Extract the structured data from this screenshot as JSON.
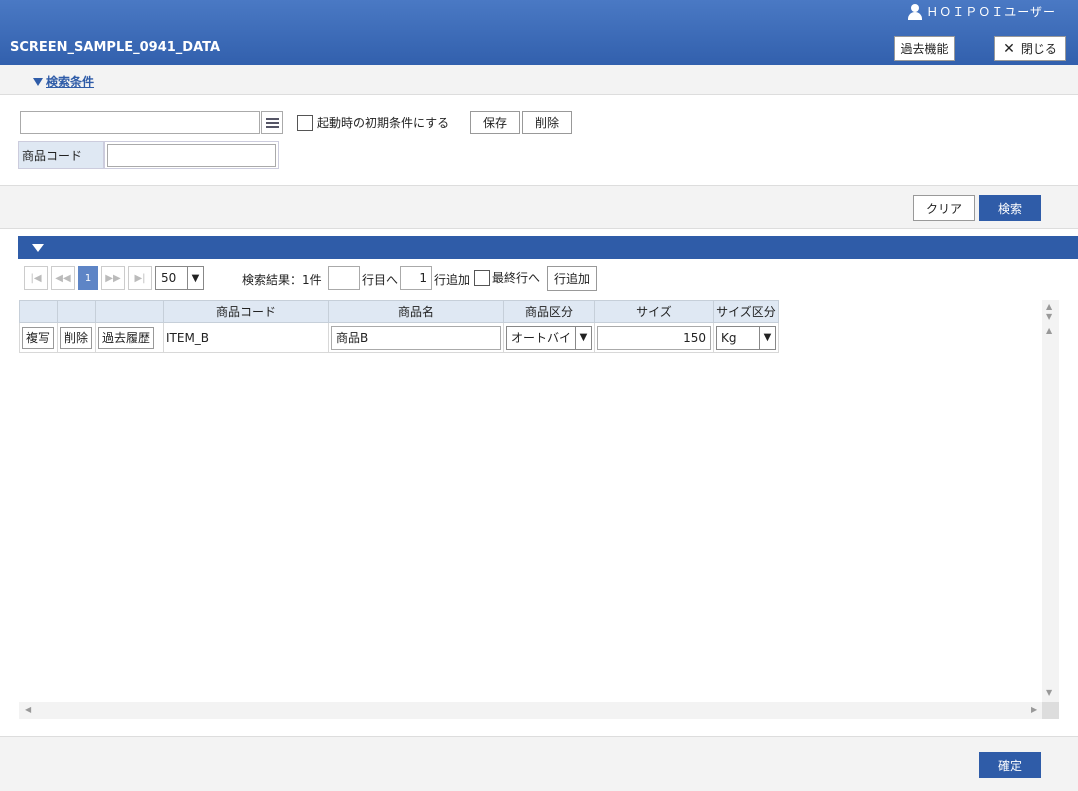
{
  "header": {
    "user": "ＨＯＩＰＯＩユーザー",
    "title": "SCREEN_SAMPLE_0941_DATA",
    "past_button": "過去機能",
    "close_button": "閉じる"
  },
  "search": {
    "toggle_label": "検索条件",
    "initial_condition_label": "起動時の初期条件にする",
    "save_button": "保存",
    "delete_button": "削除",
    "product_code_label": "商品コード",
    "product_code_value": "",
    "clear_button": "クリア",
    "search_button": "検索"
  },
  "pager": {
    "current_page": "1",
    "rows_per_page": "50",
    "result_text": "検索結果：1件",
    "row_to_label": "行目へ",
    "add_count": "1",
    "add_label": "行追加",
    "last_row_label": "最終行へ",
    "add_row_button": "行追加"
  },
  "table": {
    "columns": [
      "",
      "",
      "",
      "商品コード",
      "商品名",
      "商品区分",
      "サイズ",
      "サイズ区分"
    ],
    "rows": [
      {
        "copy": "複写",
        "delete": "削除",
        "history": "過去履歴",
        "product_code": "ITEM_B",
        "product_name": "商品B",
        "product_category": "オートバイ",
        "size": "150",
        "size_unit": "Kg"
      }
    ]
  },
  "footer": {
    "confirm_button": "確定"
  }
}
